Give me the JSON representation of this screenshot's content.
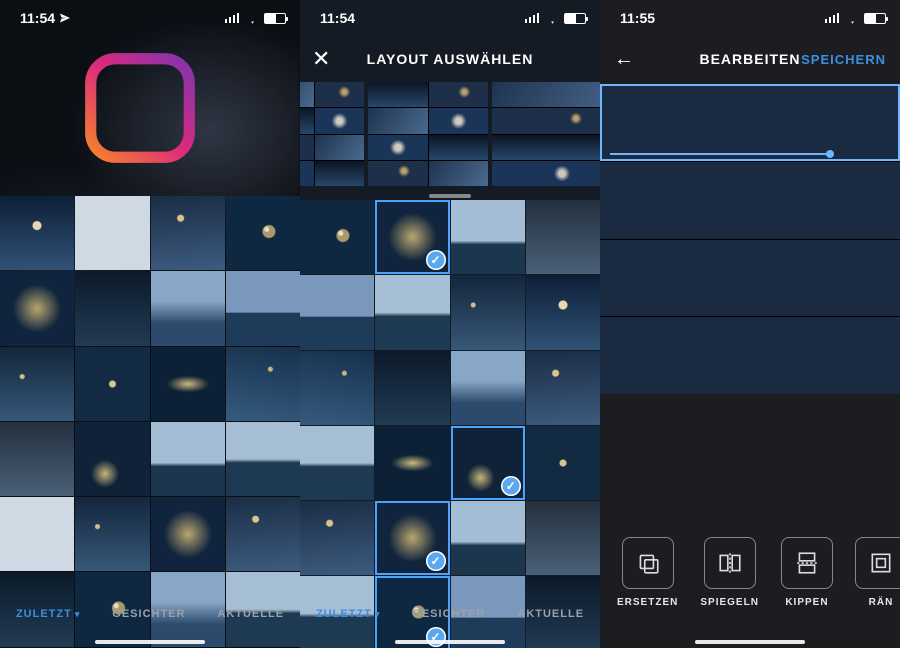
{
  "status": {
    "time1": "11:54",
    "time2": "11:54",
    "time3": "11:55"
  },
  "screen2": {
    "title": "LAYOUT AUSWÄHLEN",
    "close_icon": "✕"
  },
  "screen3": {
    "title": "BEARBEITEN",
    "save": "SPEICHERN",
    "back_icon": "←"
  },
  "tabs": {
    "recent": "ZULETZT",
    "faces": "GESICHTER",
    "current": "AKTUELLE"
  },
  "actions": {
    "replace": "ERSETZEN",
    "mirror": "SPIEGELN",
    "flip": "KIPPEN",
    "border": "RÄN"
  },
  "icons": {
    "location": "send-icon",
    "check": "✓",
    "chevron": "▾"
  }
}
